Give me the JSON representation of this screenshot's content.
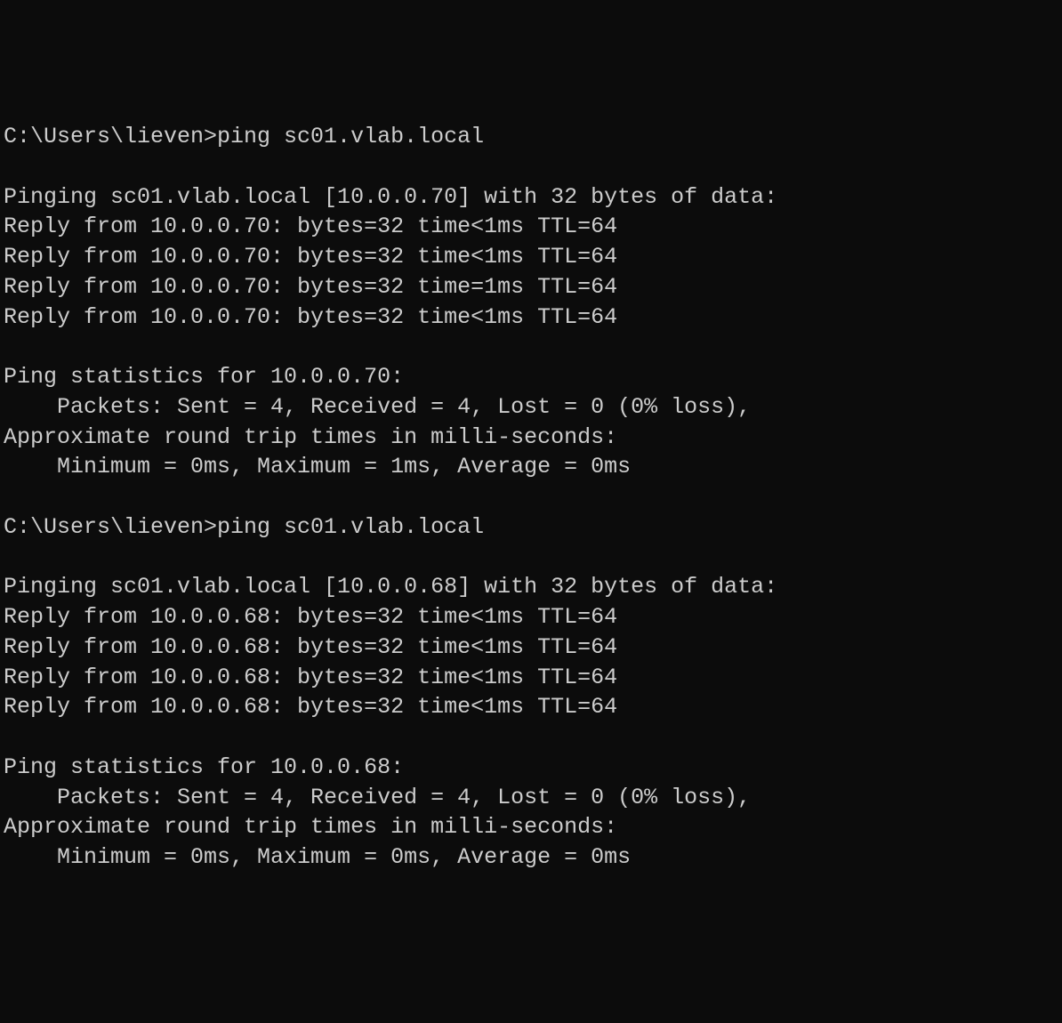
{
  "terminal": {
    "lines": [
      "C:\\Users\\lieven>ping sc01.vlab.local",
      "",
      "Pinging sc01.vlab.local [10.0.0.70] with 32 bytes of data:",
      "Reply from 10.0.0.70: bytes=32 time<1ms TTL=64",
      "Reply from 10.0.0.70: bytes=32 time<1ms TTL=64",
      "Reply from 10.0.0.70: bytes=32 time=1ms TTL=64",
      "Reply from 10.0.0.70: bytes=32 time<1ms TTL=64",
      "",
      "Ping statistics for 10.0.0.70:",
      "    Packets: Sent = 4, Received = 4, Lost = 0 (0% loss),",
      "Approximate round trip times in milli-seconds:",
      "    Minimum = 0ms, Maximum = 1ms, Average = 0ms",
      "",
      "C:\\Users\\lieven>ping sc01.vlab.local",
      "",
      "Pinging sc01.vlab.local [10.0.0.68] with 32 bytes of data:",
      "Reply from 10.0.0.68: bytes=32 time<1ms TTL=64",
      "Reply from 10.0.0.68: bytes=32 time<1ms TTL=64",
      "Reply from 10.0.0.68: bytes=32 time<1ms TTL=64",
      "Reply from 10.0.0.68: bytes=32 time<1ms TTL=64",
      "",
      "Ping statistics for 10.0.0.68:",
      "    Packets: Sent = 4, Received = 4, Lost = 0 (0% loss),",
      "Approximate round trip times in milli-seconds:",
      "    Minimum = 0ms, Maximum = 0ms, Average = 0ms"
    ]
  }
}
